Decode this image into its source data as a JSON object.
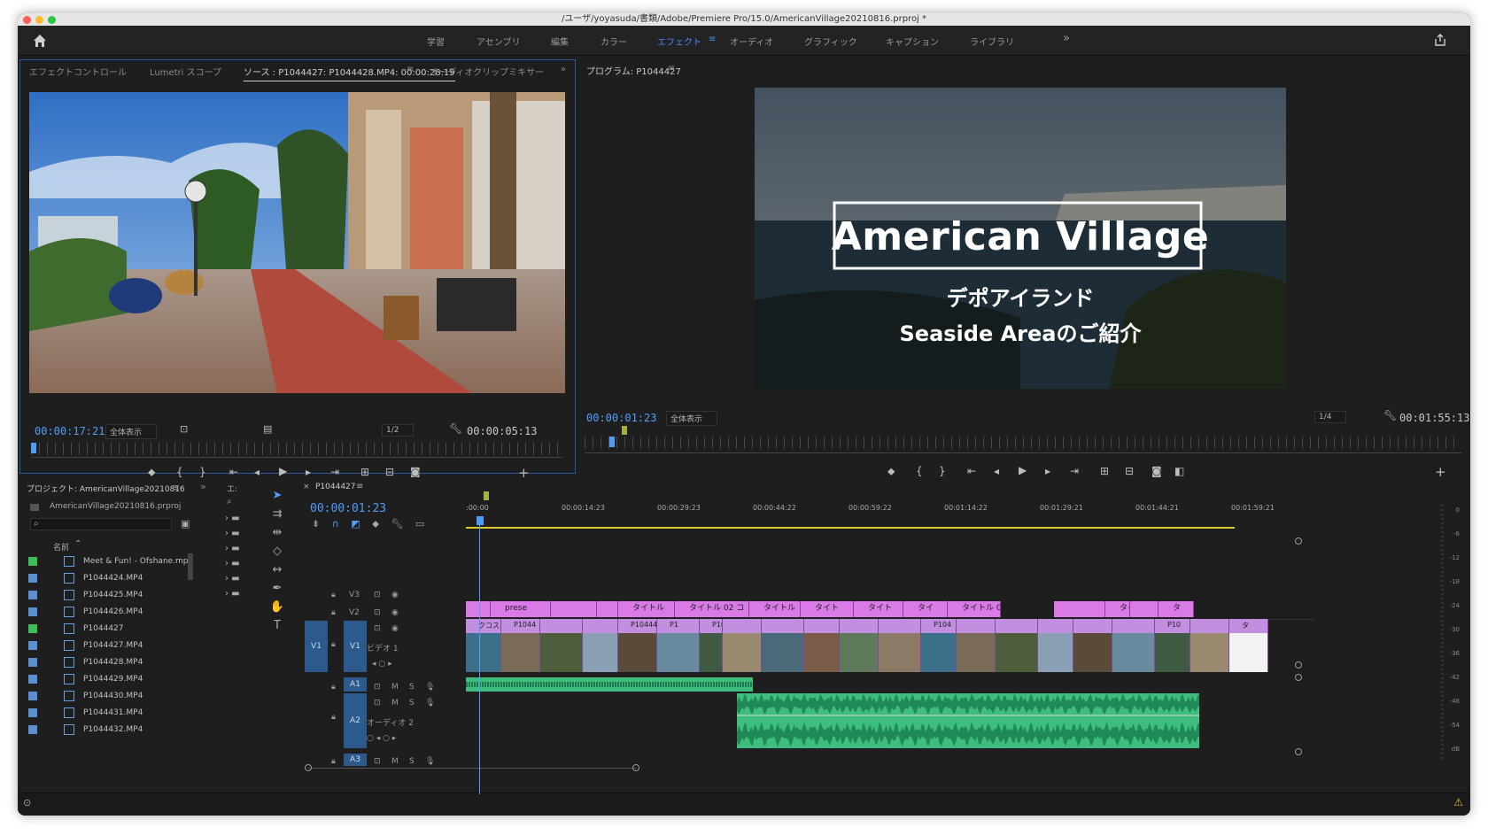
{
  "window": {
    "title": "/ユーザ/yoyasuda/書類/Adobe/Premiere Pro/15.0/AmericanVillage20210816.prproj *"
  },
  "workspaces": [
    "学習",
    "アセンブリ",
    "編集",
    "カラー",
    "エフェクト",
    "オーディオ",
    "グラフィック",
    "キャプション",
    "ライブラリ"
  ],
  "workspace_active": "エフェクト",
  "workspace_more": "»",
  "source": {
    "tabs": [
      "エフェクトコントロール",
      "Lumetri スコープ",
      "ソース : P1044427: P1044428.MP4: 00:00:28:19",
      "オーディオクリップミキサー"
    ],
    "current_tc": "00:00:17:21",
    "zoom": "全体表示",
    "resolution": "1/2",
    "duration_tc": "00:00:05:13"
  },
  "program": {
    "tab": "プログラム: P1044427",
    "current_tc": "00:00:01:23",
    "zoom": "全体表示",
    "resolution": "1/4",
    "duration_tc": "00:01:55:13",
    "title_main": "American Village",
    "title_sub1": "デポアイランド",
    "title_sub2": "Seaside Areaのご紹介"
  },
  "project": {
    "tab": "プロジェクト: AmericanVillage20210816",
    "file": "AmericanVillage20210816.prproj",
    "col_name": "名前",
    "items": [
      {
        "name": "Meet & Fun! - Ofshane.mp3",
        "color": "#3fbd5a"
      },
      {
        "name": "P1044424.MP4",
        "color": "#5b8fd0"
      },
      {
        "name": "P1044425.MP4",
        "color": "#5b8fd0"
      },
      {
        "name": "P1044426.MP4",
        "color": "#5b8fd0"
      },
      {
        "name": "P1044427",
        "color": "#3fbd5a"
      },
      {
        "name": "P1044427.MP4",
        "color": "#5b8fd0"
      },
      {
        "name": "P1044428.MP4",
        "color": "#5b8fd0"
      },
      {
        "name": "P1044429.MP4",
        "color": "#5b8fd0"
      },
      {
        "name": "P1044430.MP4",
        "color": "#5b8fd0"
      },
      {
        "name": "P1044431.MP4",
        "color": "#5b8fd0"
      },
      {
        "name": "P1044432.MP4",
        "color": "#5b8fd0"
      }
    ]
  },
  "effects_tab": "エ:",
  "timeline": {
    "tab": "P1044427",
    "current_tc": "00:00:01:23",
    "ruler": [
      ":00:00",
      "00:00:14:23",
      "00:00:29:23",
      "00:00:44:22",
      "00:00:59:22",
      "00:01:14:22",
      "00:01:29:21",
      "00:01:44:21",
      "00:01:59:21"
    ],
    "tracks": {
      "v3": "V3",
      "v2": "V2",
      "v1": "V1",
      "video1": "ビデオ 1",
      "a1": "A1",
      "a2": "A2",
      "audio2": "オーディオ 2",
      "a3": "A3",
      "m": "M",
      "s": "S"
    },
    "title_clips": [
      "prese",
      "タイトル",
      "タイトル 02 コ",
      "タイトル",
      "タイト",
      "タイト",
      "タイ",
      "タイトル 0",
      "タイト",
      "タ"
    ],
    "video_clips": [
      "クコス",
      "P1044",
      "P104442",
      "P1",
      "P104",
      "P104",
      "P10",
      "タ"
    ]
  },
  "meter": {
    "scale": [
      "0",
      "-6",
      "-12",
      "-18",
      "-24",
      "-30",
      "-36",
      "-42",
      "-48",
      "-54",
      "dB"
    ]
  }
}
